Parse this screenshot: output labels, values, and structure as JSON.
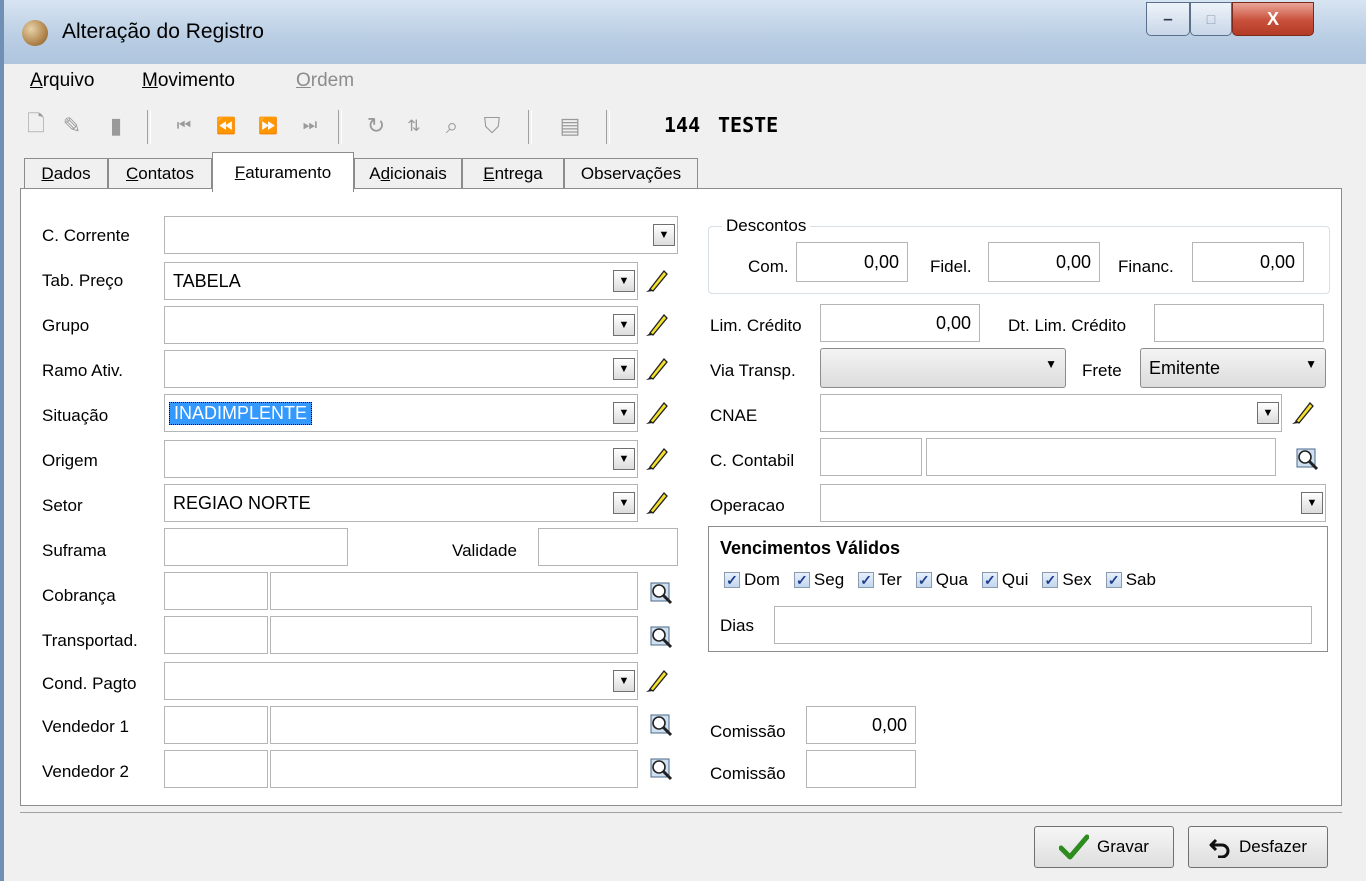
{
  "window": {
    "title": "Alteração do Registro",
    "controls": {
      "minimize": "–",
      "maximize": "□",
      "close": "X"
    }
  },
  "menu": [
    {
      "label_pre": "",
      "label_u": "A",
      "label_post": "rquivo",
      "disabled": false
    },
    {
      "label_pre": "",
      "label_u": "M",
      "label_post": "ovimento",
      "disabled": false
    },
    {
      "label_pre": "",
      "label_u": "O",
      "label_post": "rdem",
      "disabled": true
    }
  ],
  "toolbar": {
    "icons": [
      "new-icon",
      "edit-icon",
      "delete-icon",
      "first-record-icon",
      "prev-record-icon",
      "next-record-icon",
      "last-record-icon",
      "refresh-icon",
      "sort-icon",
      "find-icon",
      "filter-icon",
      "print-icon"
    ],
    "record_id": "144",
    "record_name": "TESTE"
  },
  "tabs": {
    "dados": {
      "pre": "",
      "u": "D",
      "post": "ados"
    },
    "contatos": {
      "pre": "",
      "u": "C",
      "post": "ontatos"
    },
    "faturamento": {
      "pre": "",
      "u": "F",
      "post": "aturamento"
    },
    "adicionais": {
      "pre": "A",
      "u": "d",
      "post": "icionais"
    },
    "entrega": {
      "pre": "",
      "u": "E",
      "post": "ntrega"
    },
    "observacoes": {
      "pre": "",
      "u": "",
      "post": "Observações"
    }
  },
  "left": {
    "c_corrente": {
      "label": "C. Corrente",
      "value": ""
    },
    "tab_preco": {
      "label": "Tab. Preço",
      "value": "TABELA"
    },
    "grupo": {
      "label": "Grupo",
      "value": ""
    },
    "ramo_ativ": {
      "label": "Ramo Ativ.",
      "value": ""
    },
    "situacao": {
      "label": "Situação",
      "value": "INADIMPLENTE"
    },
    "origem": {
      "label": "Origem",
      "value": ""
    },
    "setor": {
      "label": "Setor",
      "value": "REGIAO NORTE"
    },
    "suframa": {
      "label": "Suframa",
      "value": ""
    },
    "validade": {
      "label": "Validade",
      "value": ""
    },
    "cobranca": {
      "label": "Cobrança",
      "code": "",
      "desc": ""
    },
    "transportad": {
      "label": "Transportad.",
      "code": "",
      "desc": ""
    },
    "cond_pagto": {
      "label": "Cond. Pagto",
      "value": ""
    },
    "vendedor1": {
      "label": "Vendedor 1",
      "code": "",
      "desc": ""
    },
    "vendedor2": {
      "label": "Vendedor 2",
      "code": "",
      "desc": ""
    }
  },
  "right": {
    "descontos": {
      "title": "Descontos",
      "com_label": "Com.",
      "com_value": "0,00",
      "fidel_label": "Fidel.",
      "fidel_value": "0,00",
      "financ_label": "Financ.",
      "financ_value": "0,00"
    },
    "lim_credito": {
      "label": "Lim. Crédito",
      "value": "0,00"
    },
    "dt_lim_credito": {
      "label": "Dt. Lim. Crédito",
      "value": ""
    },
    "via_transp": {
      "label": "Via Transp.",
      "value": ""
    },
    "frete": {
      "label": "Frete",
      "value": "Emitente"
    },
    "cnae": {
      "label": "CNAE",
      "value": ""
    },
    "c_contabil": {
      "label": "C. Contabil",
      "code": "",
      "desc": ""
    },
    "operacao": {
      "label": "Operacao",
      "value": ""
    },
    "vencimentos": {
      "title": "Vencimentos Válidos",
      "days": [
        {
          "label": "Dom",
          "checked": true
        },
        {
          "label": "Seg",
          "checked": true
        },
        {
          "label": "Ter",
          "checked": true
        },
        {
          "label": "Qua",
          "checked": true
        },
        {
          "label": "Qui",
          "checked": true
        },
        {
          "label": "Sex",
          "checked": true
        },
        {
          "label": "Sab",
          "checked": true
        }
      ],
      "dias_label": "Dias",
      "dias_value": ""
    },
    "comissao1": {
      "label": "Comissão",
      "value": "0,00"
    },
    "comissao2": {
      "label": "Comissão",
      "value": ""
    }
  },
  "buttons": {
    "gravar": "Gravar",
    "desfazer": "Desfazer"
  },
  "colors": {
    "selection": "#3399ff",
    "window_bg": "#f0f0f0",
    "close_button": "#c9503a"
  }
}
